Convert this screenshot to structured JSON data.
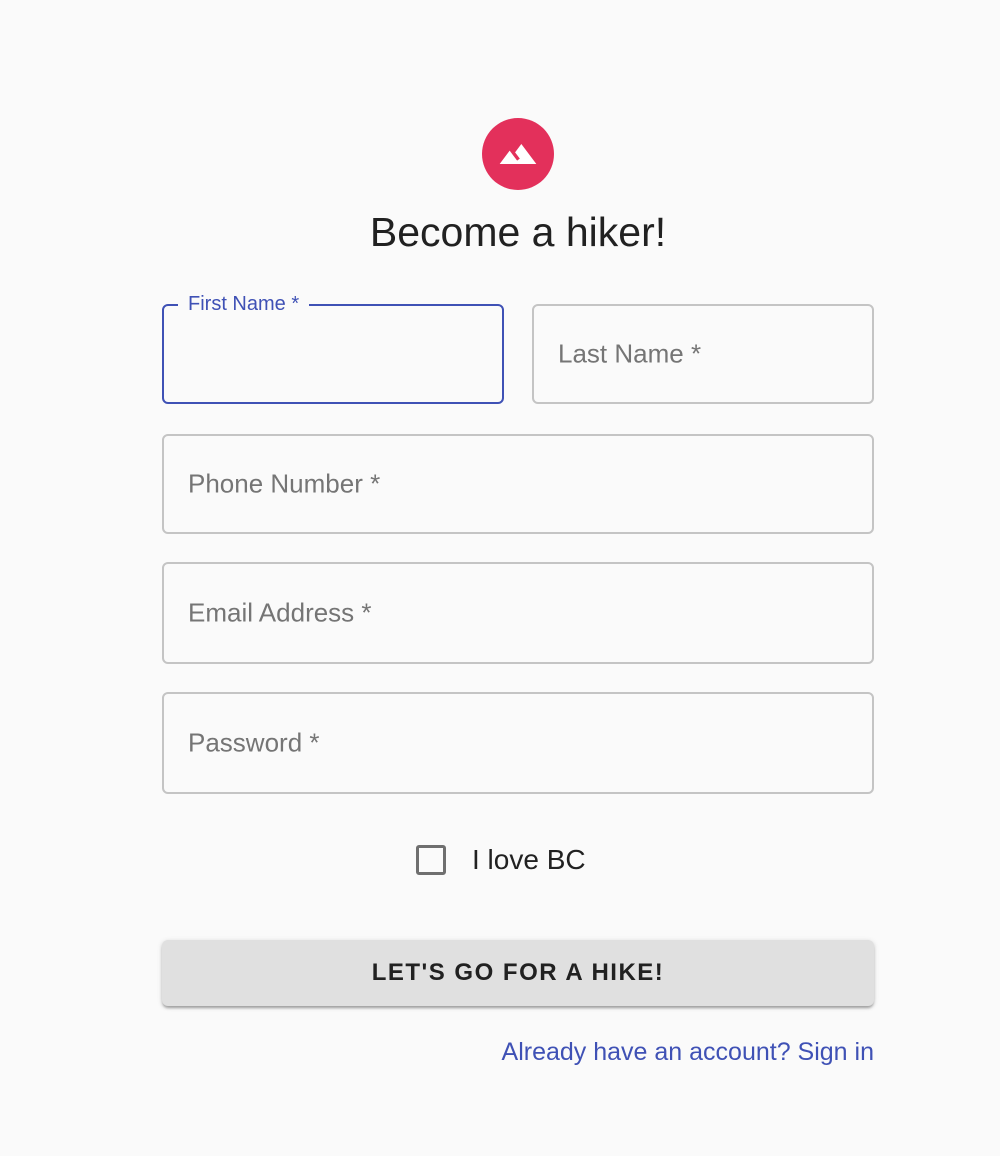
{
  "header": {
    "avatar_icon": "terrain-icon",
    "avatar_color": "#e3305b",
    "title": "Become a hiker!"
  },
  "form": {
    "first_name": {
      "label": "First Name *",
      "value": "",
      "focused": true
    },
    "last_name": {
      "label": "Last Name *",
      "value": ""
    },
    "phone": {
      "label": "Phone Number *",
      "value": ""
    },
    "email": {
      "label": "Email Address *",
      "value": ""
    },
    "password": {
      "label": "Password *",
      "value": ""
    },
    "checkbox": {
      "label": "I love BC",
      "checked": false
    },
    "submit_label": "LET'S GO FOR A HIKE!",
    "signin_link": "Already have an account? Sign in"
  },
  "colors": {
    "primary": "#3f51b5",
    "accent": "#e3305b",
    "background": "#fafafa"
  }
}
